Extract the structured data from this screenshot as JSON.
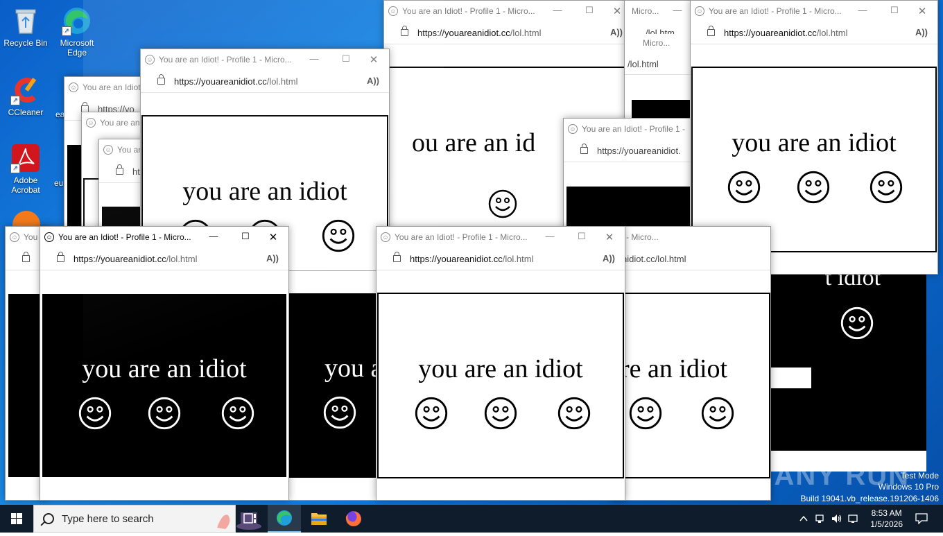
{
  "desktop": {
    "icons": [
      {
        "label": "Recycle Bin",
        "icon": "recycle-bin-icon"
      },
      {
        "label": "Microsoft Edge",
        "icon": "edge-icon"
      },
      {
        "label": "CCleaner",
        "icon": "ccleaner-icon"
      },
      {
        "label": "Adobe Acrobat",
        "icon": "acrobat-icon"
      }
    ],
    "partial_labels": [
      "ea",
      "eu"
    ]
  },
  "window": {
    "title": "You are an Idiot! - Profile 1 - Micro...",
    "title_short": "You are an Idiot! - Profile 1 - Micro",
    "title_shorter": "You are an Idiot! - Profile 1 - ",
    "title_frag_1": "You are an Idiot",
    "title_frag_2": "You are an",
    "title_frag_3": "You ar",
    "title_frag_4": "You",
    "title_frag_5": "Micro...",
    "title_frag_6": "1 - Micro...",
    "url_host": "https://youareanidiot.cc",
    "url_path": "/lol.html",
    "url_frag_1": "https://yo",
    "url_frag_2": "ht",
    "url_frag_3": "https://youareanidiot.",
    "url_frag_4": "nidiot.cc/lol.html",
    "url_frag_5": "/lol.html",
    "url_frag_6": "/lol.htm",
    "read_aloud": "A))",
    "minimize": "—",
    "maximize": "☐",
    "close": "✕"
  },
  "page": {
    "headline": "you are an idiot",
    "headline_frag_1": "ou are an id",
    "headline_frag_2": "re an idiot",
    "headline_frag_3": "you a",
    "headline_frag_4": "t idiot"
  },
  "taskbar": {
    "search_placeholder": "Type here to search",
    "time": "8:53 AM",
    "date": "1/5/2026"
  },
  "watermark": {
    "line1": "Test Mode",
    "line2": "Windows 10 Pro",
    "line3": "Build 19041.vb_release.191206-1406",
    "brand": "ANY RUN"
  },
  "colors": {
    "taskbar": "#0f1c2b",
    "desktop": "#0c6fd6",
    "accent": "#76b9ed"
  }
}
